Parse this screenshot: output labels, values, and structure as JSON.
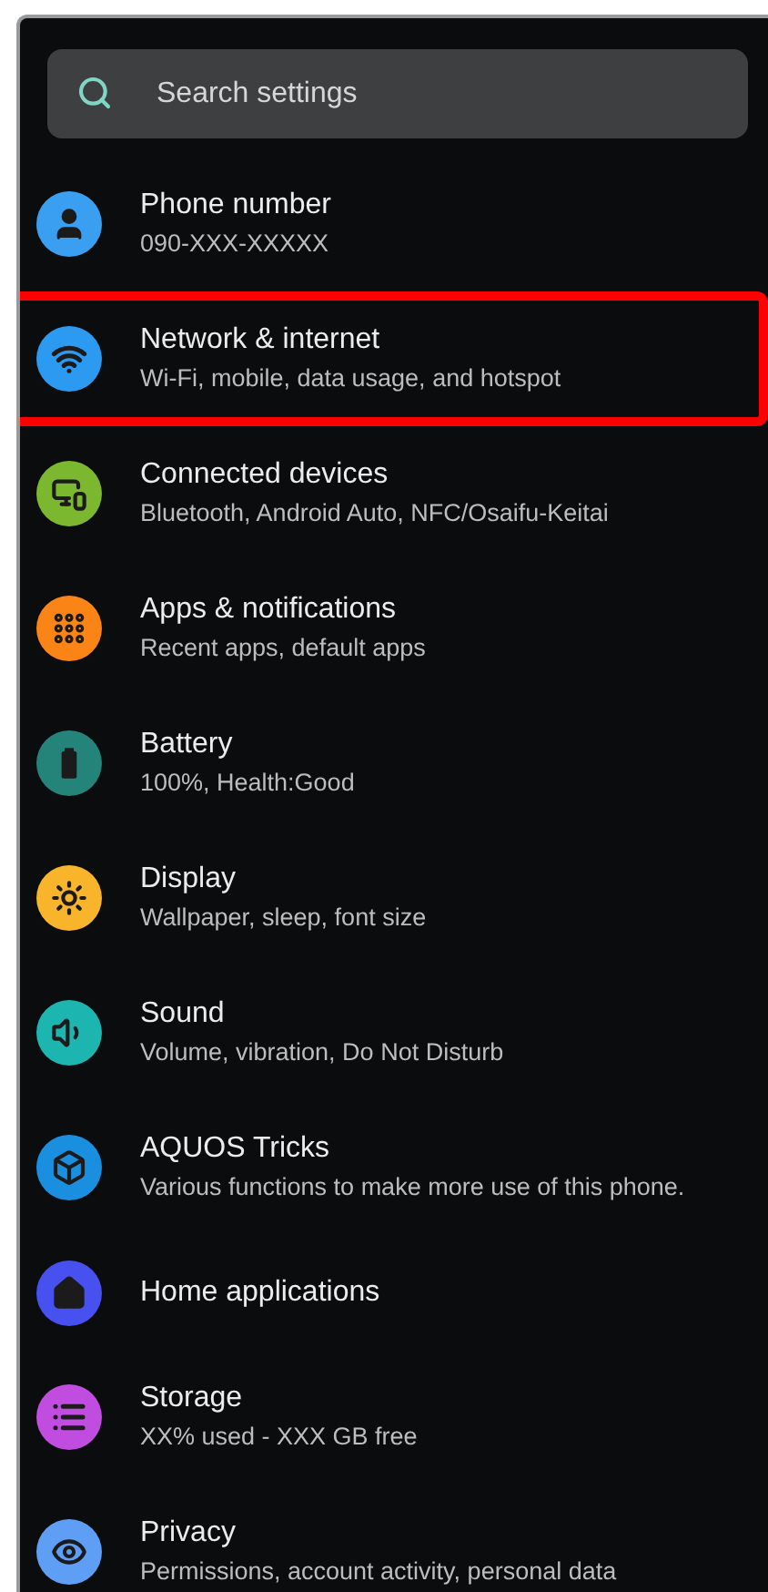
{
  "search": {
    "placeholder": "Search settings"
  },
  "items": [
    {
      "title": "Phone number",
      "subtitle": "090-XXX-XXXXX",
      "color": "#3a9ff0",
      "highlighted": false
    },
    {
      "title": "Network & internet",
      "subtitle": "Wi-Fi, mobile, data usage, and hotspot",
      "color": "#2c9af0",
      "highlighted": true
    },
    {
      "title": "Connected devices",
      "subtitle": "Bluetooth, Android Auto, NFC/Osaifu-Keitai",
      "color": "#7cb82f",
      "highlighted": false
    },
    {
      "title": "Apps & notifications",
      "subtitle": "Recent apps, default apps",
      "color": "#fb8417",
      "highlighted": false
    },
    {
      "title": "Battery",
      "subtitle": "100%, Health:Good",
      "color": "#258479",
      "highlighted": false
    },
    {
      "title": "Display",
      "subtitle": "Wallpaper, sleep, font size",
      "color": "#f8b42a",
      "highlighted": false
    },
    {
      "title": "Sound",
      "subtitle": "Volume, vibration, Do Not Disturb",
      "color": "#1cb5b0",
      "highlighted": false
    },
    {
      "title": "AQUOS Tricks",
      "subtitle": "Various functions to make more use of this phone.",
      "color": "#1a8fe0",
      "highlighted": false
    },
    {
      "title": "Home applications",
      "color": "#4651ef",
      "highlighted": false
    },
    {
      "title": "Storage",
      "subtitle": "XX% used - XXX GB free",
      "color": "#c04de0",
      "highlighted": false
    },
    {
      "title": "Privacy",
      "subtitle": "Permissions, account activity, personal data",
      "color": "#5e9ef5",
      "highlighted": false
    }
  ]
}
